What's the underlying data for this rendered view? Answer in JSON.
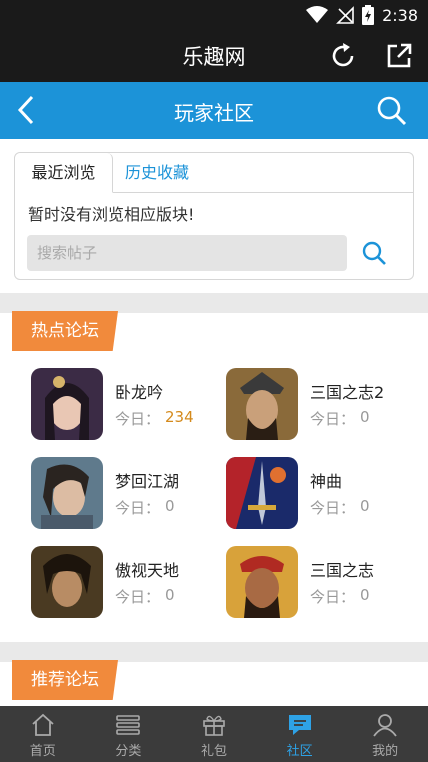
{
  "status_bar": {
    "time": "2:38",
    "icons": [
      "wifi-icon",
      "no-signal-icon",
      "battery-charging-icon"
    ]
  },
  "app_bar": {
    "title": "乐趣网",
    "icons": [
      "refresh-icon",
      "share-icon"
    ]
  },
  "page_header": {
    "title": "玩家社区",
    "icons": [
      "back-arrow-icon",
      "search-icon"
    ]
  },
  "browse": {
    "tabs": [
      {
        "label": "最近浏览",
        "active": true
      },
      {
        "label": "历史收藏",
        "active": false
      }
    ],
    "empty_message": "暂时没有浏览相应版块!",
    "search_placeholder": "搜索帖子"
  },
  "hot_forums": {
    "title": "热点论坛",
    "forums": [
      {
        "name": "卧龙吟",
        "today_label": "今日：",
        "today_count": "234"
      },
      {
        "name": "三国之志2",
        "today_label": "今日：",
        "today_count": "0"
      },
      {
        "name": "梦回江湖",
        "today_label": "今日：",
        "today_count": "0"
      },
      {
        "name": "神曲",
        "today_label": "今日：",
        "today_count": "0"
      },
      {
        "name": "傲视天地",
        "today_label": "今日：",
        "today_count": "0"
      },
      {
        "name": "三国之志",
        "today_label": "今日：",
        "today_count": "0"
      }
    ]
  },
  "recommended_forums": {
    "title": "推荐论坛"
  },
  "bottom_nav": {
    "items": [
      {
        "label": "首页",
        "icon": "home-icon"
      },
      {
        "label": "分类",
        "icon": "list-icon"
      },
      {
        "label": "礼包",
        "icon": "gift-icon"
      },
      {
        "label": "社区",
        "icon": "chat-icon",
        "active": true
      },
      {
        "label": "我的",
        "icon": "user-icon"
      }
    ]
  },
  "colors": {
    "header_blue": "#1c93d8",
    "tag_orange": "#f18a3c",
    "active_nav": "#2ea2e6",
    "highlight_count": "#d48a1c"
  }
}
